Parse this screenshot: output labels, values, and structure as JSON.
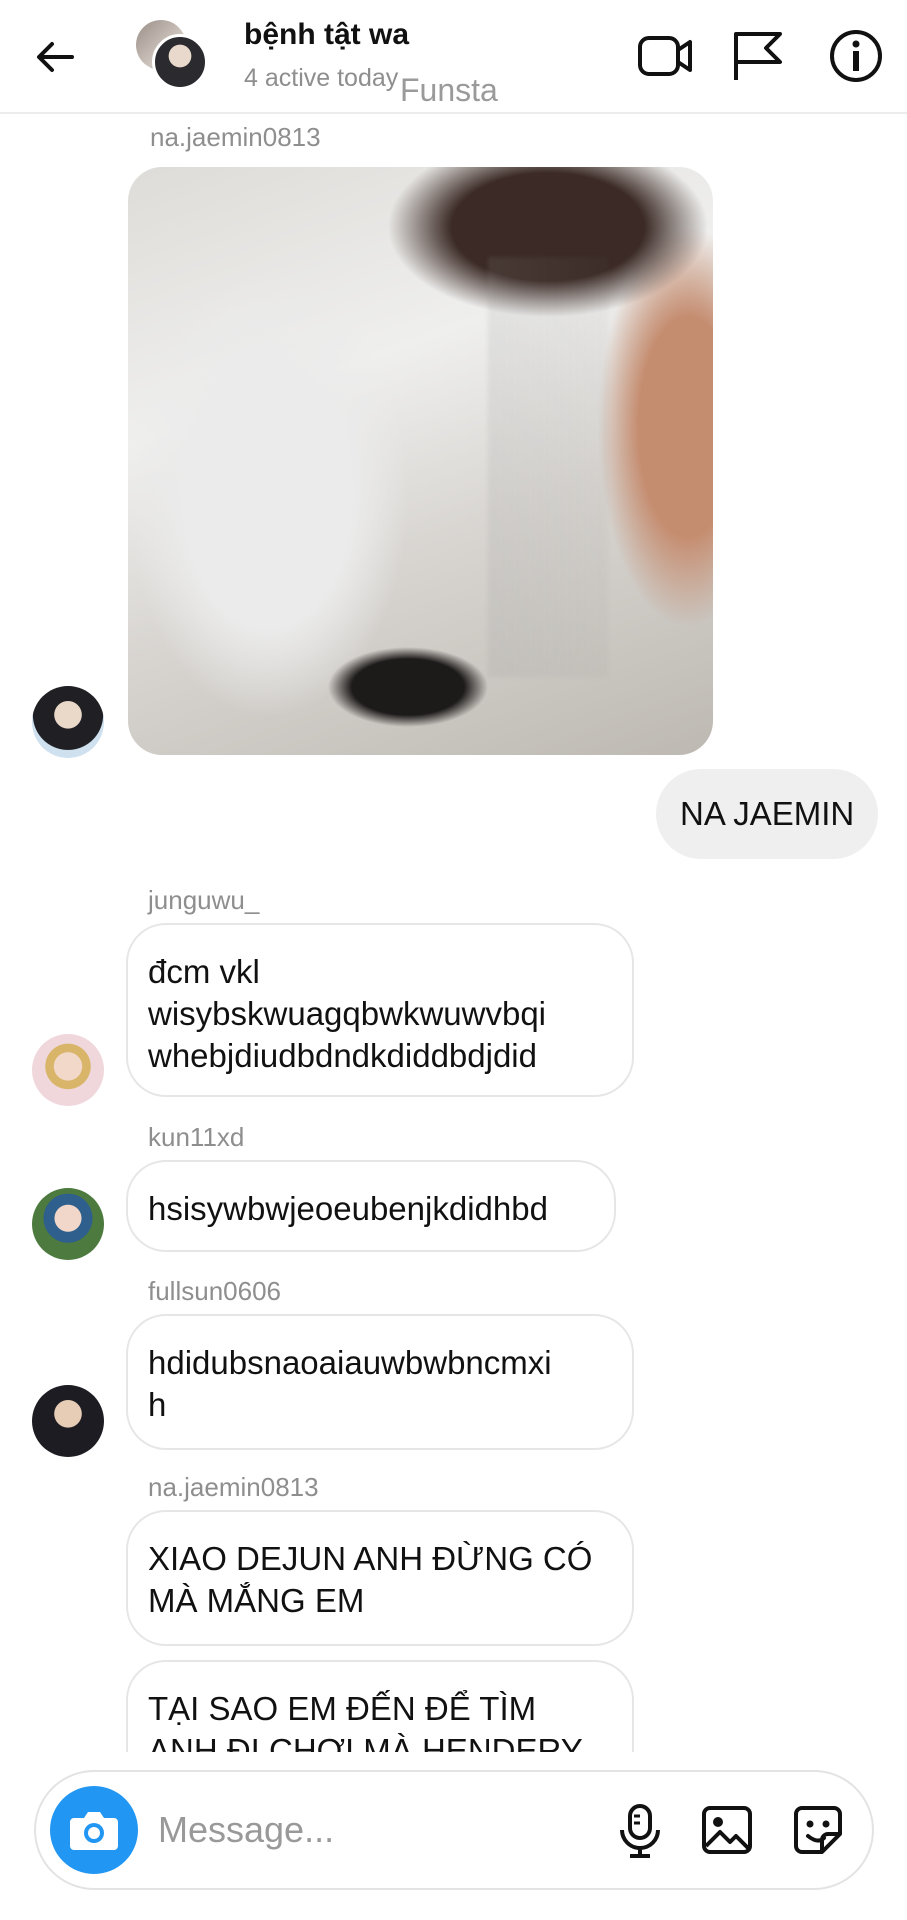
{
  "header": {
    "title": "bệnh tật wa",
    "subtitle": "4 active today",
    "overlay_label": "Funsta"
  },
  "messages": [
    {
      "sender": "na.jaemin0813",
      "type": "photo"
    },
    {
      "sender": "me",
      "text": "NA JAEMIN"
    },
    {
      "sender": "junguwu_",
      "text": "đcm vkl\nwisybskwuagqbwkwuwvbqi\nwhebjdiudbdndkdiddbdjdid"
    },
    {
      "sender": "kun11xd",
      "text": "hsisywbwjeoeubenjkdidhbd"
    },
    {
      "sender": "fullsun0606",
      "text": "hdidubsnaoaiauwbwbncmxi\nh"
    },
    {
      "sender": "na.jaemin0813",
      "text": "XIAO DEJUN ANH ĐỪNG CÓ\nMÀ MẮNG EM"
    },
    {
      "sender": "na.jaemin0813",
      "text": "TẠI SAO EM ĐẾN ĐỂ TÌM\nANH ĐI CHƠI MÀ HENDERY"
    }
  ],
  "composer": {
    "placeholder": "Message..."
  },
  "icons": {
    "header": [
      "back-arrow-icon",
      "video-call-icon",
      "flag-icon",
      "info-icon"
    ],
    "composer": [
      "camera-icon",
      "microphone-icon",
      "gallery-icon",
      "sticker-icon"
    ]
  },
  "colors": {
    "accent": "#2196f3",
    "sent_bubble": "#efefef",
    "bubble_border": "#e6e6e6",
    "secondary_text": "#8e8e8e"
  }
}
